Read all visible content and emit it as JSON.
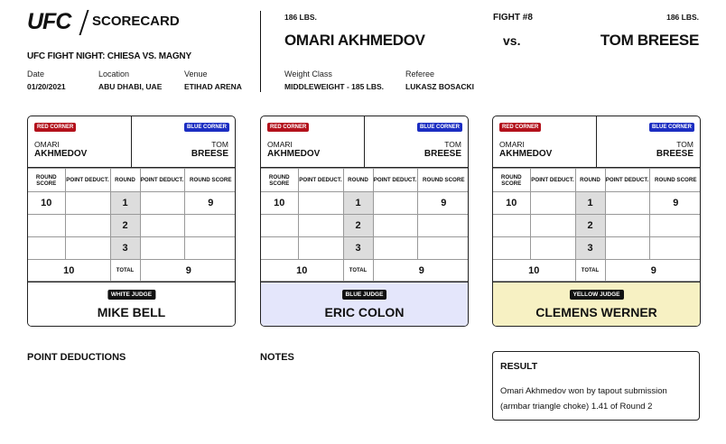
{
  "header": {
    "brand": "UFC",
    "doc_title": "SCORECARD",
    "event": "UFC FIGHT NIGHT: CHIESA VS. MAGNY",
    "date_label": "Date",
    "date": "01/20/2021",
    "location_label": "Location",
    "location": "ABU DHABI, UAE",
    "venue_label": "Venue",
    "venue": "ETIHAD ARENA"
  },
  "bout": {
    "red_weight": "186 LBS.",
    "red_name": "OMARI AKHMEDOV",
    "fight_number": "FIGHT #8",
    "vs": "vs.",
    "blue_weight": "186 LBS.",
    "blue_name": "TOM BREESE",
    "weight_class_label": "Weight Class",
    "weight_class": "MIDDLEWEIGHT - 185 LBS.",
    "referee_label": "Referee",
    "referee": "LUKASZ BOSACKI"
  },
  "card_labels": {
    "red_corner": "RED CORNER",
    "blue_corner": "BLUE CORNER",
    "red_first": "OMARI",
    "red_last": "AKHMEDOV",
    "blue_first": "TOM",
    "blue_last": "BREESE",
    "round_score": "ROUND SCORE",
    "point_deduct": "POINT DEDUCT.",
    "round": "ROUND",
    "total": "TOTAL"
  },
  "judges": [
    {
      "tag": "WHITE JUDGE",
      "name": "MIKE BELL",
      "rounds": [
        {
          "num": "1",
          "red": "10",
          "red_ded": "",
          "blue_ded": "",
          "blue": "9"
        },
        {
          "num": "2",
          "red": "",
          "red_ded": "",
          "blue_ded": "",
          "blue": ""
        },
        {
          "num": "3",
          "red": "",
          "red_ded": "",
          "blue_ded": "",
          "blue": ""
        }
      ],
      "red_total": "10",
      "blue_total": "9"
    },
    {
      "tag": "BLUE JUDGE",
      "name": "ERIC COLON",
      "rounds": [
        {
          "num": "1",
          "red": "10",
          "red_ded": "",
          "blue_ded": "",
          "blue": "9"
        },
        {
          "num": "2",
          "red": "",
          "red_ded": "",
          "blue_ded": "",
          "blue": ""
        },
        {
          "num": "3",
          "red": "",
          "red_ded": "",
          "blue_ded": "",
          "blue": ""
        }
      ],
      "red_total": "10",
      "blue_total": "9"
    },
    {
      "tag": "YELLOW JUDGE",
      "name": "CLEMENS WERNER",
      "rounds": [
        {
          "num": "1",
          "red": "10",
          "red_ded": "",
          "blue_ded": "",
          "blue": "9"
        },
        {
          "num": "2",
          "red": "",
          "red_ded": "",
          "blue_ded": "",
          "blue": ""
        },
        {
          "num": "3",
          "red": "",
          "red_ded": "",
          "blue_ded": "",
          "blue": ""
        }
      ],
      "red_total": "10",
      "blue_total": "9"
    }
  ],
  "footer": {
    "point_deductions_title": "POINT DEDUCTIONS",
    "notes_title": "NOTES",
    "result_title": "RESULT",
    "result_text": "Omari Akhmedov won by tapout submission (armbar triangle choke) 1.41 of Round 2"
  },
  "colors": {
    "red_corner": "#b3121c",
    "blue_corner": "#1c2ec2",
    "blue_judge_bg": "#e4e6fb",
    "yellow_judge_bg": "#f7f1c3"
  }
}
